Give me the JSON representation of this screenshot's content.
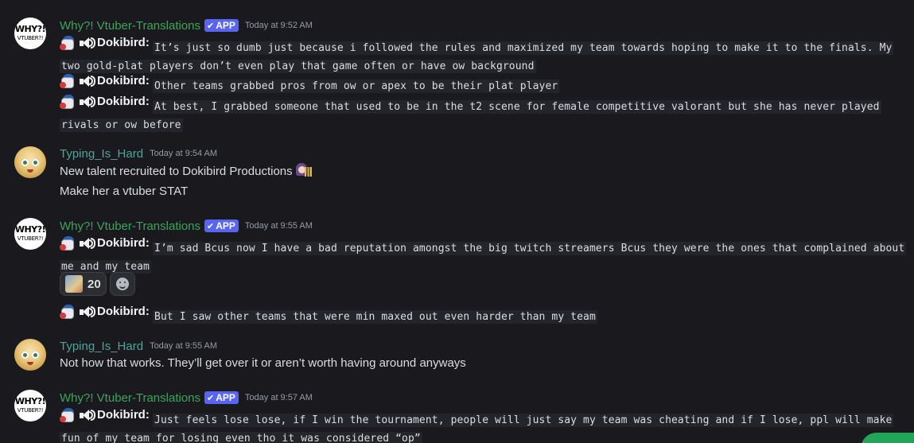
{
  "messages": [
    {
      "author": "Why?! Vtuber-Translations",
      "badge": "APP",
      "badge_check": "✔",
      "timestamp": "Today at 9:52 AM",
      "avatar_line1": "WHY?!",
      "avatar_line2": "VTUBER?!",
      "lines": [
        {
          "speaker": "Dokibird:",
          "text": "It’s just so dumb just because i followed the rules and maximized my team towards hoping to make it to the finals. My two gold-plat players don’t even play that game often or have ow background "
        },
        {
          "speaker": "Dokibird:",
          "text": "Other teams grabbed pros from ow or apex to be their plat player "
        },
        {
          "speaker": "Dokibird:",
          "text": "At best, I grabbed someone that used to be in the t2 scene for female competitive valorant but she has never played rivals or ow before "
        }
      ]
    },
    {
      "author": "Typing_Is_Hard",
      "timestamp": "Today at 9:54 AM",
      "lines": [
        {
          "text": "New talent recruited to Dokibird Productions"
        },
        {
          "text": "Make her a vtuber STAT"
        }
      ]
    },
    {
      "author": "Why?! Vtuber-Translations",
      "badge": "APP",
      "badge_check": "✔",
      "timestamp": "Today at 9:55 AM",
      "avatar_line1": "WHY?!",
      "avatar_line2": "VTUBER?!",
      "lines": [
        {
          "speaker": "Dokibird:",
          "text": "I’m sad Bcus now I have a bad reputation amongst the big twitch streamers Bcus they were the ones that complained about me and my team "
        },
        {
          "speaker": "Dokibird:",
          "text": "But I saw other teams that were min maxed out even harder than my team"
        }
      ],
      "reaction": {
        "count": "20"
      }
    },
    {
      "author": "Typing_Is_Hard",
      "timestamp": "Today at 9:55 AM",
      "lines": [
        {
          "text": "Not how that works. They’ll get over it or aren’t worth having around anyways"
        }
      ]
    },
    {
      "author": "Why?! Vtuber-Translations",
      "badge": "APP",
      "badge_check": "✔",
      "timestamp": "Today at 9:57 AM",
      "avatar_line1": "WHY?!",
      "avatar_line2": "VTUBER?!",
      "lines": [
        {
          "speaker": "Dokibird:",
          "text": "Just feels lose lose, if I win the tournament, people will just say my team was cheating and if I lose, ppl will make fun of my team for losing even tho it was considered “op”"
        }
      ]
    }
  ],
  "colors": {
    "background": "#1a1a1e",
    "bot_name": "#3ba55c",
    "user_name": "#4fa39a",
    "badge": "#5865f2",
    "timestamp": "#949ba4",
    "text": "#dbdee1"
  }
}
